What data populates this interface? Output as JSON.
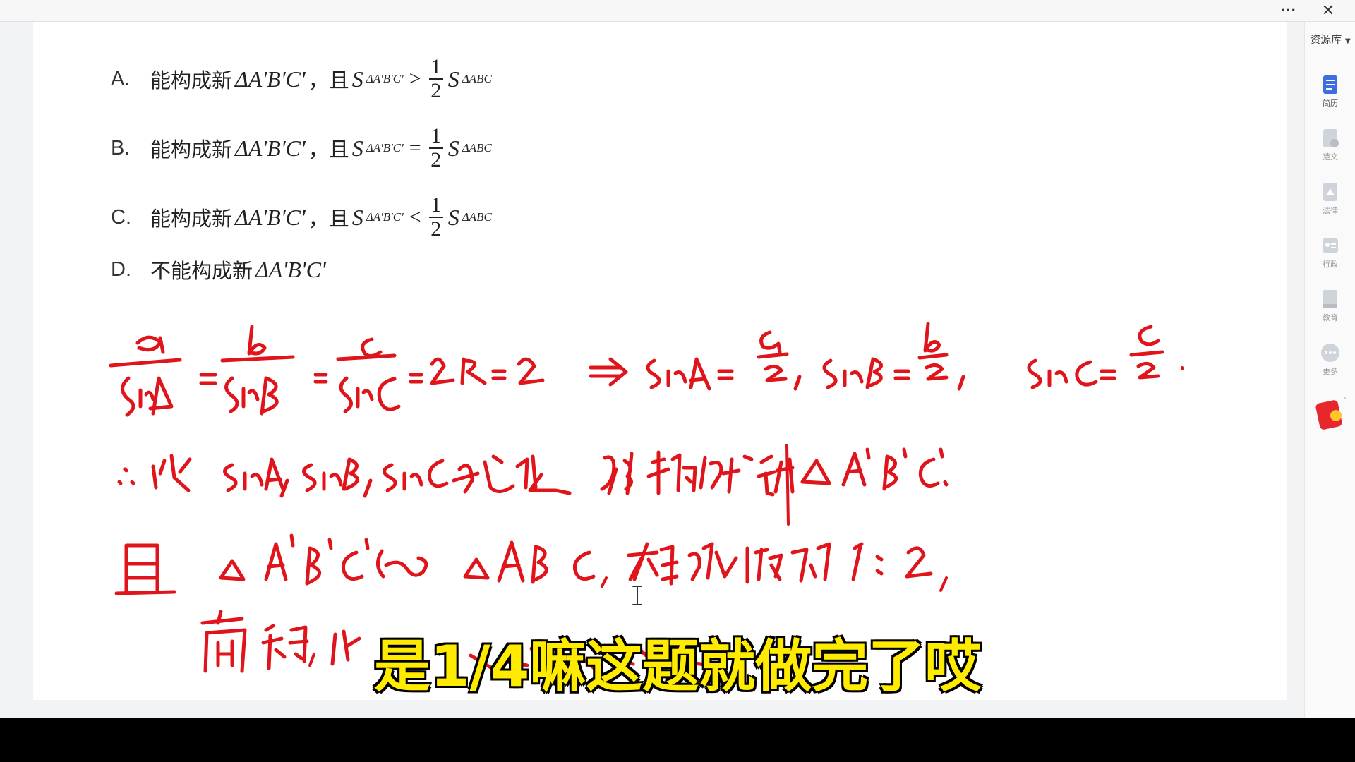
{
  "titlebar": {
    "more": "···",
    "close": "✕"
  },
  "question": {
    "options": [
      {
        "letter": "A.",
        "text": "能构成新",
        "tri": "ΔA'B'C'",
        "conj": "，且",
        "S": "S",
        "sub1": "ΔA'B'C'",
        "rel": ">",
        "num": "1",
        "den": "2",
        "sub2": "ΔABC"
      },
      {
        "letter": "B.",
        "text": "能构成新",
        "tri": "ΔA'B'C'",
        "conj": "，且",
        "S": "S",
        "sub1": "ΔA'B'C'",
        "rel": "=",
        "num": "1",
        "den": "2",
        "sub2": "ΔABC"
      },
      {
        "letter": "C.",
        "text": "能构成新",
        "tri": "ΔA'B'C'",
        "conj": "，且",
        "S": "S",
        "sub1": "ΔA'B'C'",
        "rel": "<",
        "num": "1",
        "den": "2",
        "sub2": "ΔABC"
      },
      {
        "letter": "D.",
        "text": "不能构成新",
        "tri": "ΔA'B'C'"
      }
    ]
  },
  "handwriting": {
    "line1": "a/sinA = b/sinB = c/sinC = 2R = 2 ⟹ sinA = a/2, sinB = b/2, sinC = c/2.",
    "line2": "∴以 sinA, sinB, sinC 为边长能构成新 ΔA'B'C'",
    "line3": "且 ΔA'B'C' ∽ ΔABC, 相似比为 1:2,",
    "line4": "面积比",
    "color": "#e0141b"
  },
  "sidepanel": {
    "top": "资源库",
    "items": [
      {
        "label": "简历",
        "icon": "resume-icon",
        "active": true
      },
      {
        "label": "范文",
        "icon": "sample-essay-icon"
      },
      {
        "label": "法律",
        "icon": "law-icon"
      },
      {
        "label": "行政",
        "icon": "admin-icon"
      },
      {
        "label": "教育",
        "icon": "education-icon"
      },
      {
        "label": "更多",
        "icon": "more-icon"
      }
    ]
  },
  "subtitle": "是1/4嘛这题就做完了哎"
}
